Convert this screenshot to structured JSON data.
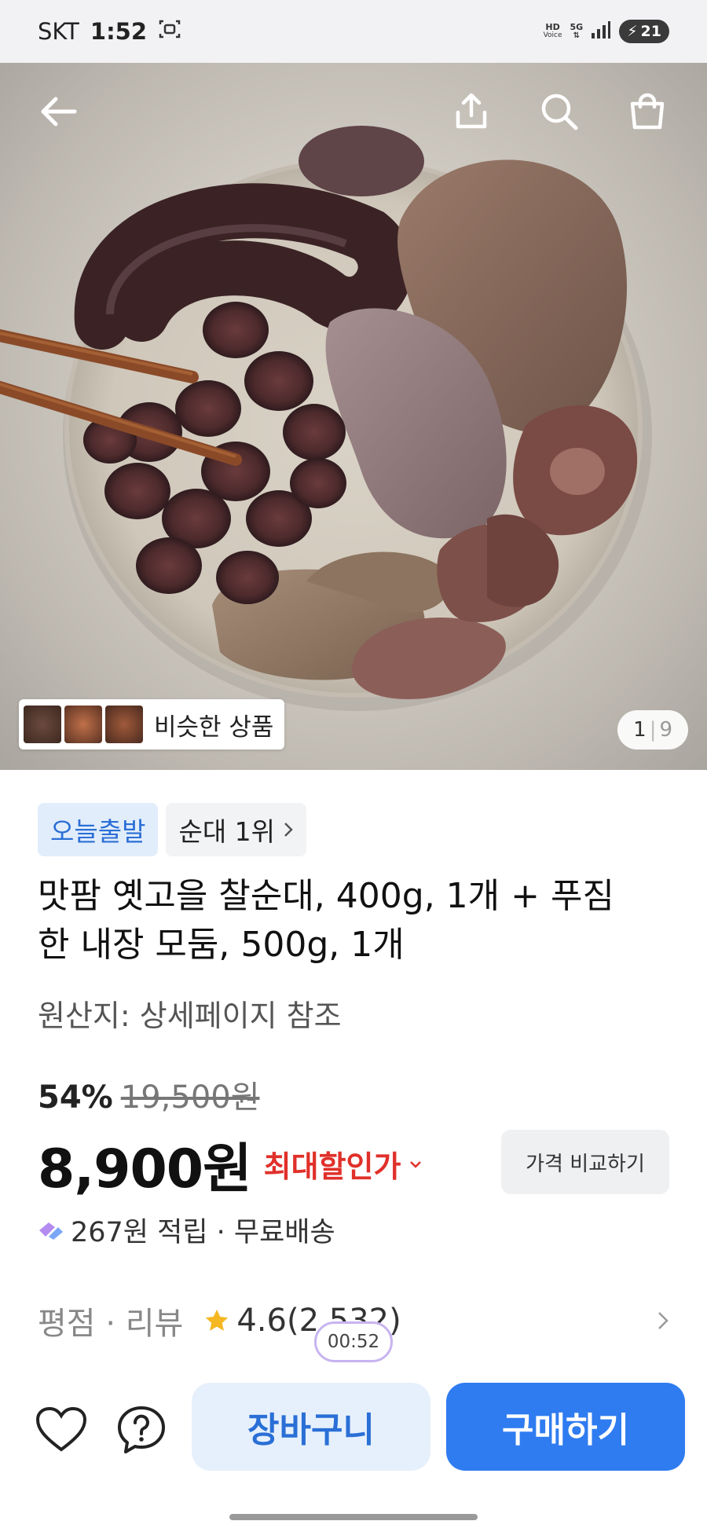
{
  "status_bar": {
    "carrier": "SKT",
    "time": "1:52",
    "hd_label": "HD",
    "voice_label": "Voice",
    "network": "5G",
    "battery": "21"
  },
  "hero": {
    "back_icon": "arrow-left-icon",
    "share_icon": "share-icon",
    "search_icon": "search-icon",
    "bag_icon": "shopping-bag-icon",
    "similar_label": "비슷한 상품",
    "page_current": "1",
    "page_total": "9"
  },
  "product": {
    "badge_today": "오늘출발",
    "badge_rank": "순대 1위",
    "title": "맛팜 옛고을 찰순대, 400g, 1개 + 푸짐한 내장 모둠, 500g, 1개",
    "origin": "원산지: 상세페이지 참조",
    "discount": "54%",
    "original_price": "19,500원",
    "price": "8,900원",
    "max_discount": "최대할인가",
    "compare_label": "가격 비교하기",
    "points": "267원 적립 · 무료배송"
  },
  "review": {
    "label": "평점 · 리뷰",
    "rating": "4.6",
    "count": "(2,532)",
    "timer": "00:52"
  },
  "bottom_bar": {
    "wishlist_icon": "heart-icon",
    "help_icon": "question-icon",
    "cart_label": "장바구니",
    "buy_label": "구매하기"
  },
  "colors": {
    "accent_blue": "#2f7cf0",
    "discount_red": "#e0302a",
    "badge_blue_bg": "#e2edfb"
  }
}
